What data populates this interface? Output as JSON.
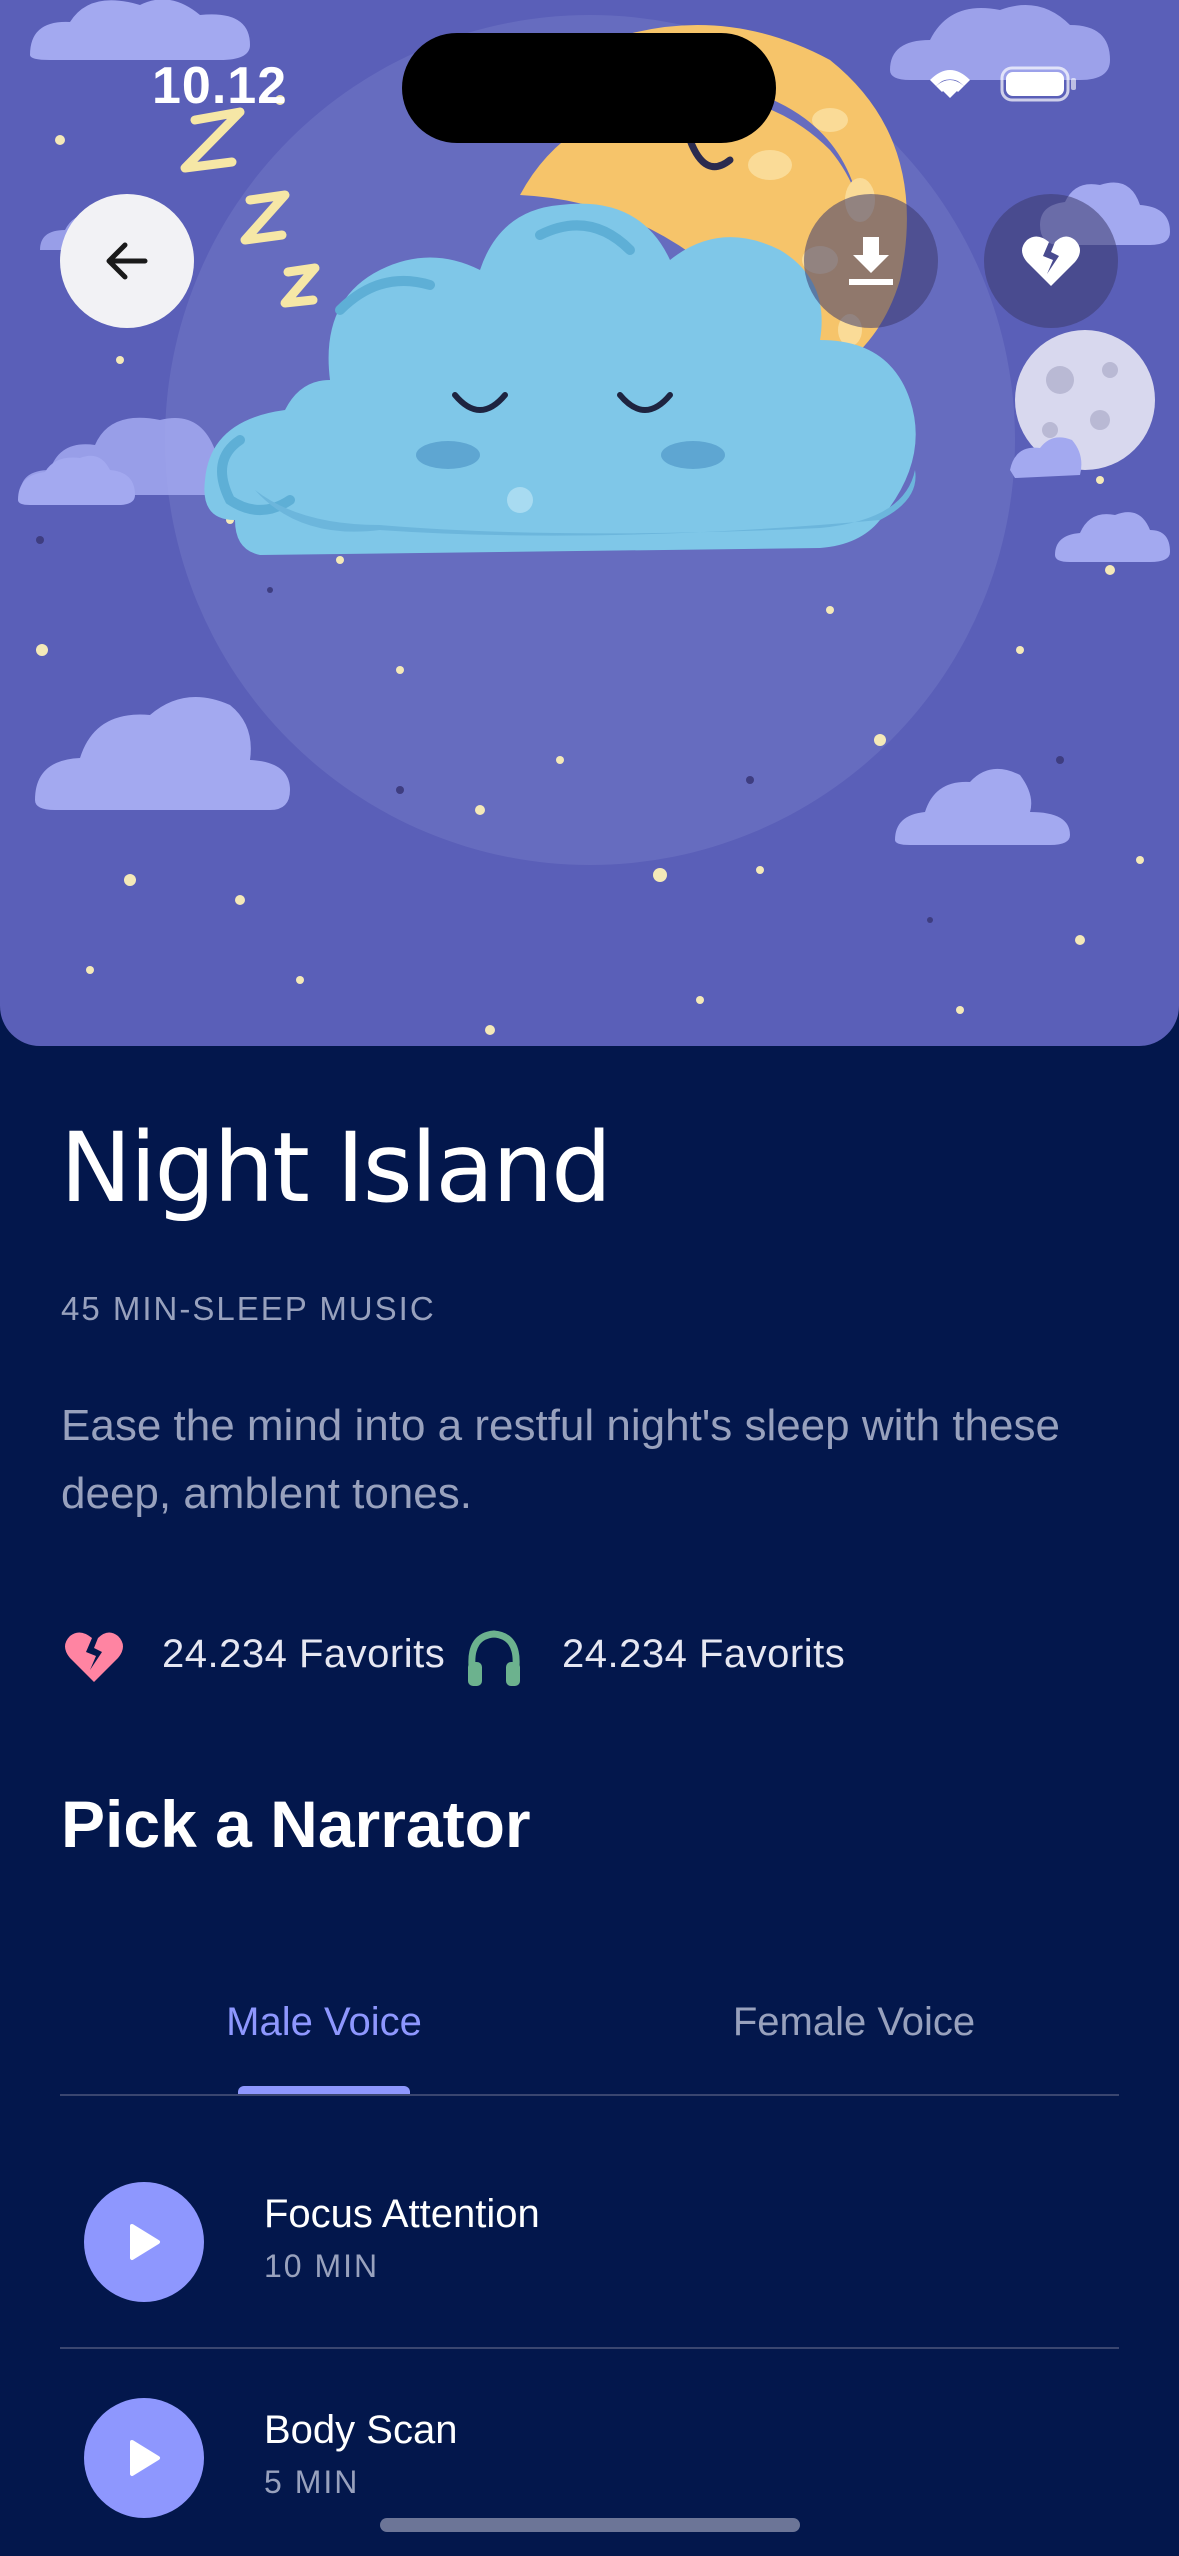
{
  "status_bar": {
    "time": "10.12"
  },
  "header": {
    "back_icon": "arrow-left-icon",
    "download_icon": "download-icon",
    "favorite_icon": "broken-heart-icon"
  },
  "track": {
    "title": "Night Island",
    "subtitle": "45 MIN-SLEEP MUSIC",
    "description": "Ease the mind into a restful night's sleep  with these deep, amblent tones."
  },
  "stats": {
    "favorites": "24.234 Favorits",
    "listening": "24.234 Favorits"
  },
  "narrator": {
    "title": "Pick a Narrator",
    "tabs": [
      {
        "label": "Male Voice",
        "active": true
      },
      {
        "label": "Female Voice",
        "active": false
      }
    ],
    "items": [
      {
        "name": "Focus Attention",
        "duration": "10 MIN"
      },
      {
        "name": "Body Scan",
        "duration": "5 MIN"
      }
    ]
  },
  "colors": {
    "background": "#03174C",
    "hero": "#5A5FB8",
    "accent": "#8E97FE",
    "muted_text": "#98A1BD",
    "heart": "#FF84A2",
    "headphones": "#6CB28E"
  }
}
